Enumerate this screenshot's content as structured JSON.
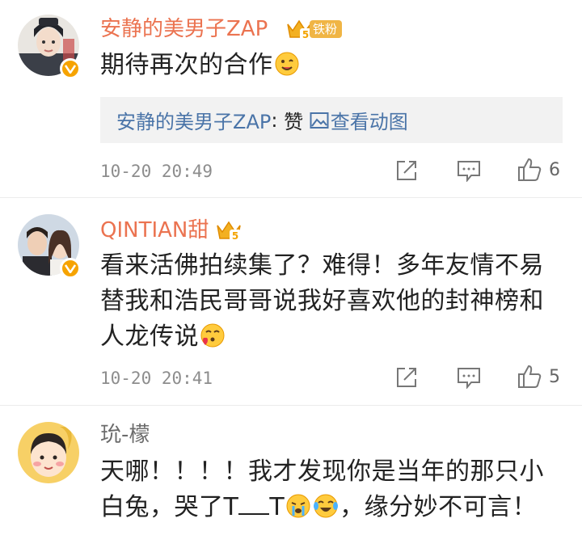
{
  "comments": [
    {
      "username": "安静的美男子ZAP",
      "fan_level": "5",
      "fan_label": "铁粉",
      "text": "期待再次的合作",
      "reply": {
        "author": "安静的美男子ZAP",
        "separator": ":",
        "content": "赞",
        "link_text": "查看动图"
      },
      "time": "10-20 20:49",
      "like_count": "6"
    },
    {
      "username": "QINTIAN甜",
      "fan_level": "5",
      "text": "看来活佛拍续集了？难得！多年友情不易 替我和浩民哥哥说我好喜欢他的封神榜和人龙传说",
      "time": "10-20 20:41",
      "like_count": "5"
    },
    {
      "username": "玧-檬",
      "text_part1": "天哪！！！！我才发现你是当年的那只小白兔，哭了T",
      "text_part2": "T",
      "text_part3": "，缘分妙不可言！"
    }
  ],
  "colors": {
    "username": "#eb7350",
    "link": "#4a74a8",
    "badge": "#f6a300",
    "time": "#8d8d8d",
    "reply_bg": "#f2f2f2"
  },
  "icons": [
    "repost-icon",
    "comment-icon",
    "thumbs-up-icon",
    "verified-icon",
    "crown-icon",
    "gif-image-icon"
  ]
}
